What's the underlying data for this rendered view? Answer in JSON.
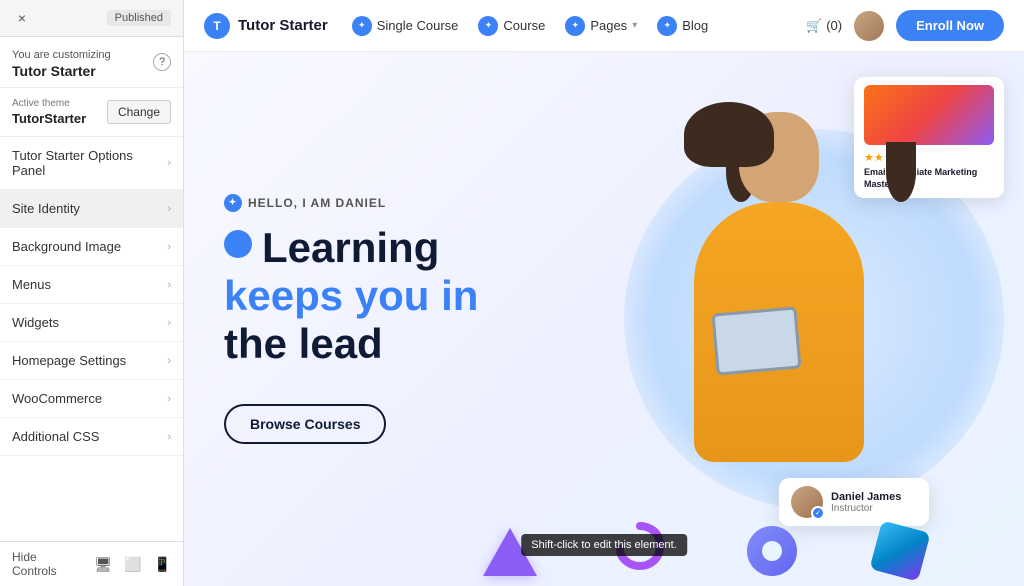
{
  "sidebar": {
    "top_bar": {
      "close_label": "×",
      "status_label": "Published"
    },
    "customizing": {
      "sub_label": "You are customizing",
      "theme_name": "Tutor Starter",
      "help_label": "?"
    },
    "active_theme": {
      "label": "Active theme",
      "name": "TutorStarter",
      "change_button": "Change"
    },
    "menu_items": [
      {
        "id": "tutor-options",
        "label": "Tutor Starter Options Panel"
      },
      {
        "id": "site-identity",
        "label": "Site Identity"
      },
      {
        "id": "background-image",
        "label": "Background Image"
      },
      {
        "id": "menus",
        "label": "Menus"
      },
      {
        "id": "widgets",
        "label": "Widgets"
      },
      {
        "id": "homepage-settings",
        "label": "Homepage Settings"
      },
      {
        "id": "woocommerce",
        "label": "WooCommerce"
      },
      {
        "id": "additional-css",
        "label": "Additional CSS"
      }
    ],
    "bottom": {
      "hide_controls": "Hide Controls"
    }
  },
  "header": {
    "logo_text": "Tutor Starter",
    "nav": [
      {
        "label": "Single Course",
        "has_icon": true
      },
      {
        "label": "Course",
        "has_icon": true
      },
      {
        "label": "Pages",
        "has_dropdown": true,
        "has_icon": true
      },
      {
        "label": "Blog",
        "has_icon": true
      }
    ],
    "cart": "(0)",
    "enroll_button": "Enroll Now"
  },
  "hero": {
    "subtitle": "HELLO, I AM DANIEL",
    "title_line1": "Learning",
    "title_line2": "keeps you in",
    "title_line3": "the lead",
    "browse_button": "Browse Courses",
    "course_card": {
      "stars": "★★★★",
      "title": "Email & Affiliate Marketing Mastermind"
    },
    "instructor": {
      "name": "Daniel James",
      "role": "Instructor"
    }
  },
  "tooltip": {
    "text": "Shift-click to edit this element."
  }
}
